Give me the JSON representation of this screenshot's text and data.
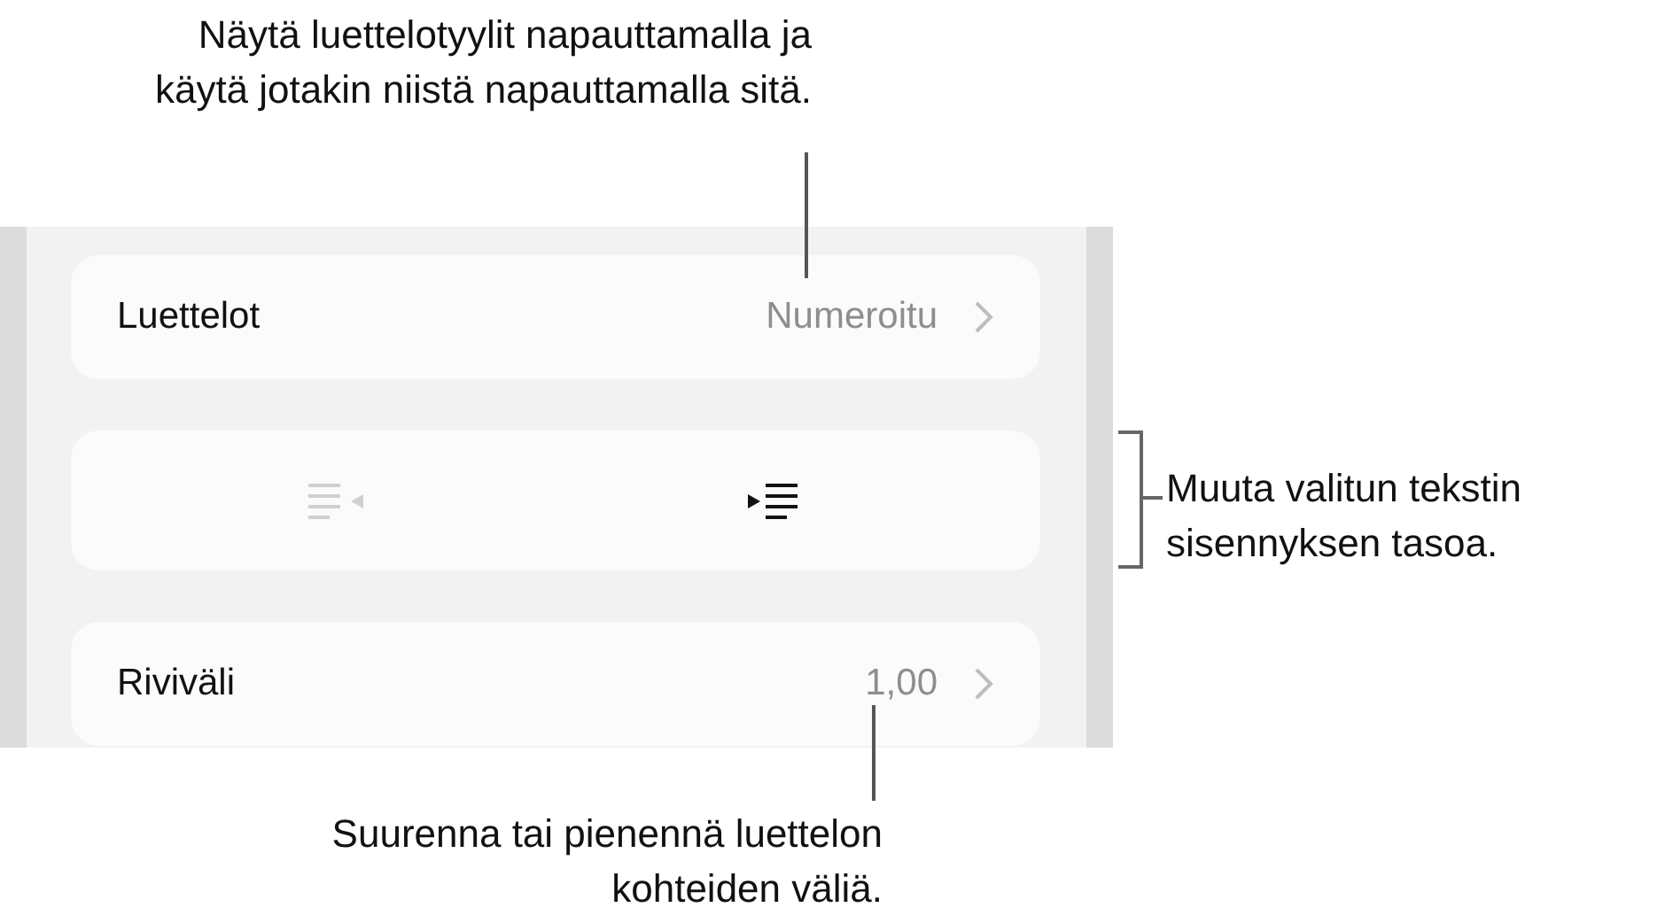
{
  "callouts": [
    {
      "kind": "top",
      "text": "Näytä luettelotyylit napauttamalla ja käytä jotakin niistä napauttamalla sitä."
    },
    {
      "kind": "right",
      "text": "Muuta valitun tekstin sisennyksen tasoa."
    },
    {
      "kind": "bottom",
      "text": "Suurenna tai pienennä luettelon kohteiden väliä."
    }
  ],
  "panel": {
    "rows": [
      {
        "kind": "setting",
        "label": "Luettelot",
        "value": "Numeroitu"
      },
      {
        "kind": "indent",
        "buttons": [
          {
            "kind": "outdent",
            "disabled": true
          },
          {
            "kind": "indent",
            "disabled": false
          }
        ]
      },
      {
        "kind": "setting",
        "label": "Riviväli",
        "value": "1,00"
      }
    ]
  }
}
